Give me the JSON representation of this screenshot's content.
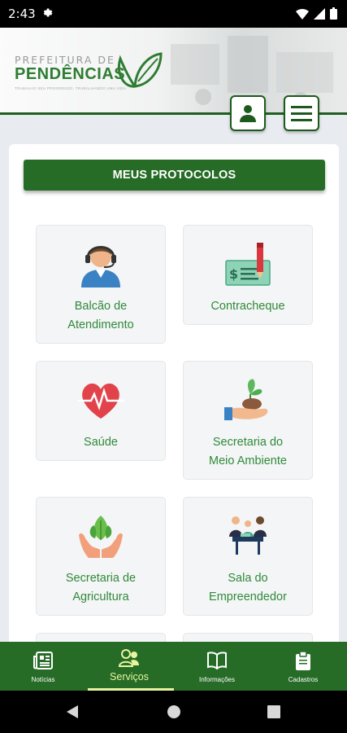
{
  "status_bar": {
    "time": "2:43"
  },
  "header": {
    "logo_line1": "PREFEITURA DE",
    "logo_line2": "PENDÊNCIAS",
    "logo_line3": "TRABALHO SEU PROGRESSO, TRABALHANDO UMA VIDA"
  },
  "protocols_button": "MEUS PROTOCOLOS",
  "services": [
    {
      "label": "Balcão de Atendimento",
      "line1": "Balcão de",
      "line2": "Atendimento"
    },
    {
      "label": "Contracheque",
      "line1": "Contracheque",
      "line2": ""
    },
    {
      "label": "Saúde",
      "line1": "Saúde",
      "line2": ""
    },
    {
      "label": "Secretaria do Meio Ambiente",
      "line1": "Secretaria do",
      "line2": "Meio Ambiente"
    },
    {
      "label": "Secretaria de Agricultura",
      "line1": "Secretaria de",
      "line2": "Agricultura"
    },
    {
      "label": "Sala do Empreendedor",
      "line1": "Sala do",
      "line2": "Empreendedor"
    }
  ],
  "bottom_nav": [
    {
      "label": "Notícias",
      "icon": "newspaper-icon"
    },
    {
      "label": "Serviços",
      "icon": "people-icon",
      "active": true
    },
    {
      "label": "Informações",
      "icon": "book-icon"
    },
    {
      "label": "Cadastros",
      "icon": "clipboard-icon"
    }
  ],
  "colors": {
    "primary": "#266b26",
    "accent_text": "#2f8a3a",
    "active_nav": "#e8f5a0"
  }
}
